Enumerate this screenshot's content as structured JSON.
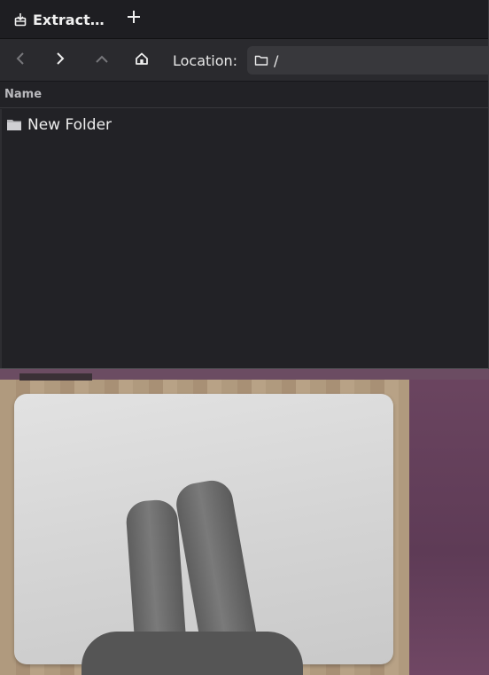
{
  "tab": {
    "title": "Extract…",
    "icon": "archive-extract-icon"
  },
  "toolbar": {
    "location_label": "Location:",
    "location_path": "/"
  },
  "list": {
    "column_name": "Name",
    "items": [
      {
        "label": "New Folder",
        "icon": "folder-icon"
      }
    ]
  },
  "photo": {
    "description_icon": "trackpad-photo"
  },
  "colors": {
    "window_bg": "#222226",
    "toolbar_bg": "#2a2a2e",
    "field_bg": "#38383c",
    "text": "#e6e6e6"
  }
}
